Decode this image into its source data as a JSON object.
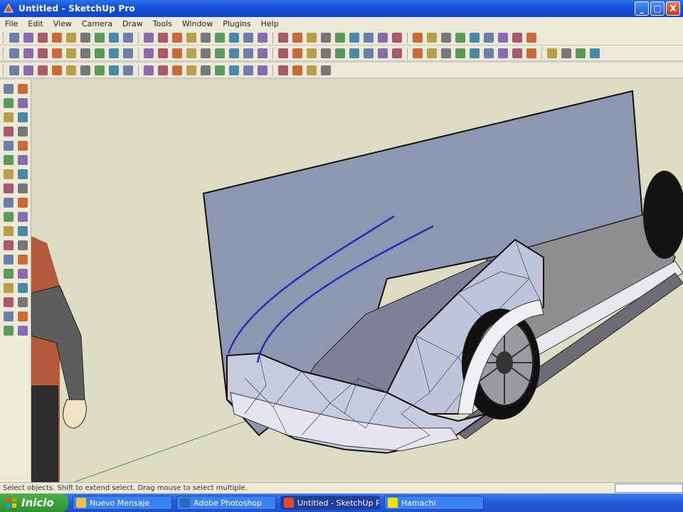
{
  "window": {
    "title": "Untitled - SketchUp Pro",
    "app_icon": "sketchup-icon",
    "controls": [
      "_",
      "□",
      "X"
    ]
  },
  "menu": [
    "File",
    "Edit",
    "View",
    "Camera",
    "Draw",
    "Tools",
    "Window",
    "Plugins",
    "Help"
  ],
  "status": {
    "hint": "Select objects. Shift to extend select. Drag mouse to select multiple."
  },
  "taskbar": {
    "start_label": "Inicio",
    "tasks": [
      {
        "label": "Nuevo Mensaje",
        "icon": "mail-icon"
      },
      {
        "label": "Adobe Photoshop",
        "icon": "photoshop-icon"
      },
      {
        "label": "Untitled - SketchUp Pro",
        "icon": "sketchup-icon"
      },
      {
        "label": "Hamachi",
        "icon": "hamachi-icon"
      }
    ]
  },
  "colors": {
    "titlebar": "#1550d6",
    "viewport_background": "#ddddc4",
    "backdrop_plane": "#8e97b2",
    "car_body": "#c7cbe0",
    "guide_curves": "#2130b8",
    "tire": "#141414"
  }
}
